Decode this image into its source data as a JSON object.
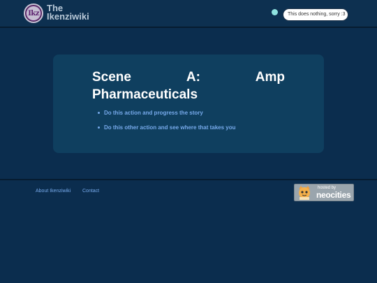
{
  "header": {
    "logo_text": "Ikz",
    "title_line1": "The",
    "title_line2": "Ikenziwiki",
    "search_placeholder": "This does nothing, sorry :3"
  },
  "card": {
    "title_words_line1": [
      "Scene",
      "A:",
      "Amp"
    ],
    "title_line2": "Pharmaceuticals",
    "choices": [
      "Do this action and progress the story",
      "Do this other action and see where that takes you"
    ]
  },
  "footer": {
    "about_link": "About Ikenziwiki",
    "contact_link": "Contact",
    "badge_small": "hosted by",
    "badge_big": "neocities"
  },
  "colors": {
    "background": "#0b2d4e",
    "card": "#0f3f5f",
    "link": "#76a9ea",
    "status_dot": "#8fe3e0"
  }
}
